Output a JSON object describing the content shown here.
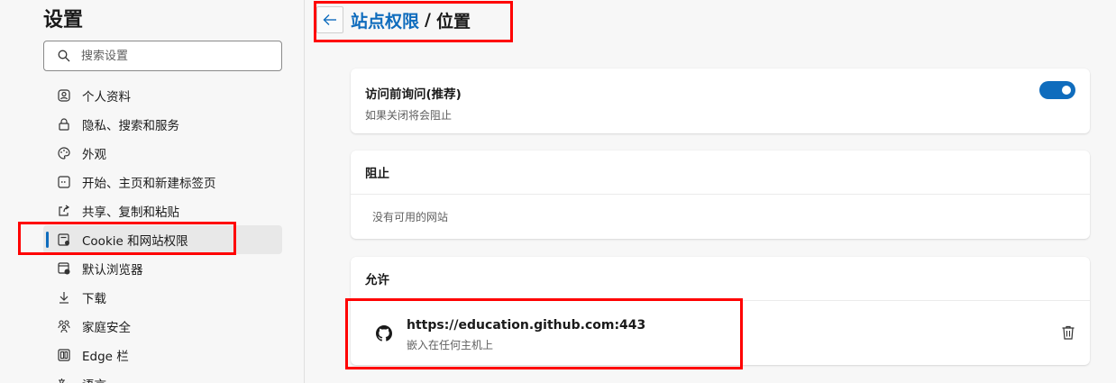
{
  "sidebar": {
    "title": "设置",
    "search_placeholder": "搜索设置",
    "items": [
      {
        "label": "个人资料",
        "icon": "profile-icon"
      },
      {
        "label": "隐私、搜索和服务",
        "icon": "lock-icon"
      },
      {
        "label": "外观",
        "icon": "palette-icon"
      },
      {
        "label": "开始、主页和新建标签页",
        "icon": "home-tab-icon"
      },
      {
        "label": "共享、复制和粘贴",
        "icon": "share-icon"
      },
      {
        "label": "Cookie 和网站权限",
        "icon": "site-permissions-icon",
        "active": true
      },
      {
        "label": "默认浏览器",
        "icon": "default-browser-icon"
      },
      {
        "label": "下载",
        "icon": "download-icon"
      },
      {
        "label": "家庭安全",
        "icon": "family-icon"
      },
      {
        "label": "Edge 栏",
        "icon": "edge-bar-icon"
      },
      {
        "label": "语言",
        "icon": "language-icon"
      }
    ]
  },
  "header": {
    "breadcrumb_parent": "站点权限",
    "separator": "/",
    "current": "位置"
  },
  "ask_card": {
    "title": "访问前询问(推荐)",
    "subtitle": "如果关闭将会阻止",
    "toggle_on": true
  },
  "block_card": {
    "title": "阻止",
    "empty_text": "没有可用的网站"
  },
  "allow_card": {
    "title": "允许",
    "sites": [
      {
        "url": "https://education.github.com:443",
        "description": "嵌入在任何主机上",
        "icon": "github-icon"
      }
    ]
  },
  "colors": {
    "accent": "#0f6cbd",
    "highlight": "#ff0000",
    "background": "#f7f7f7"
  }
}
